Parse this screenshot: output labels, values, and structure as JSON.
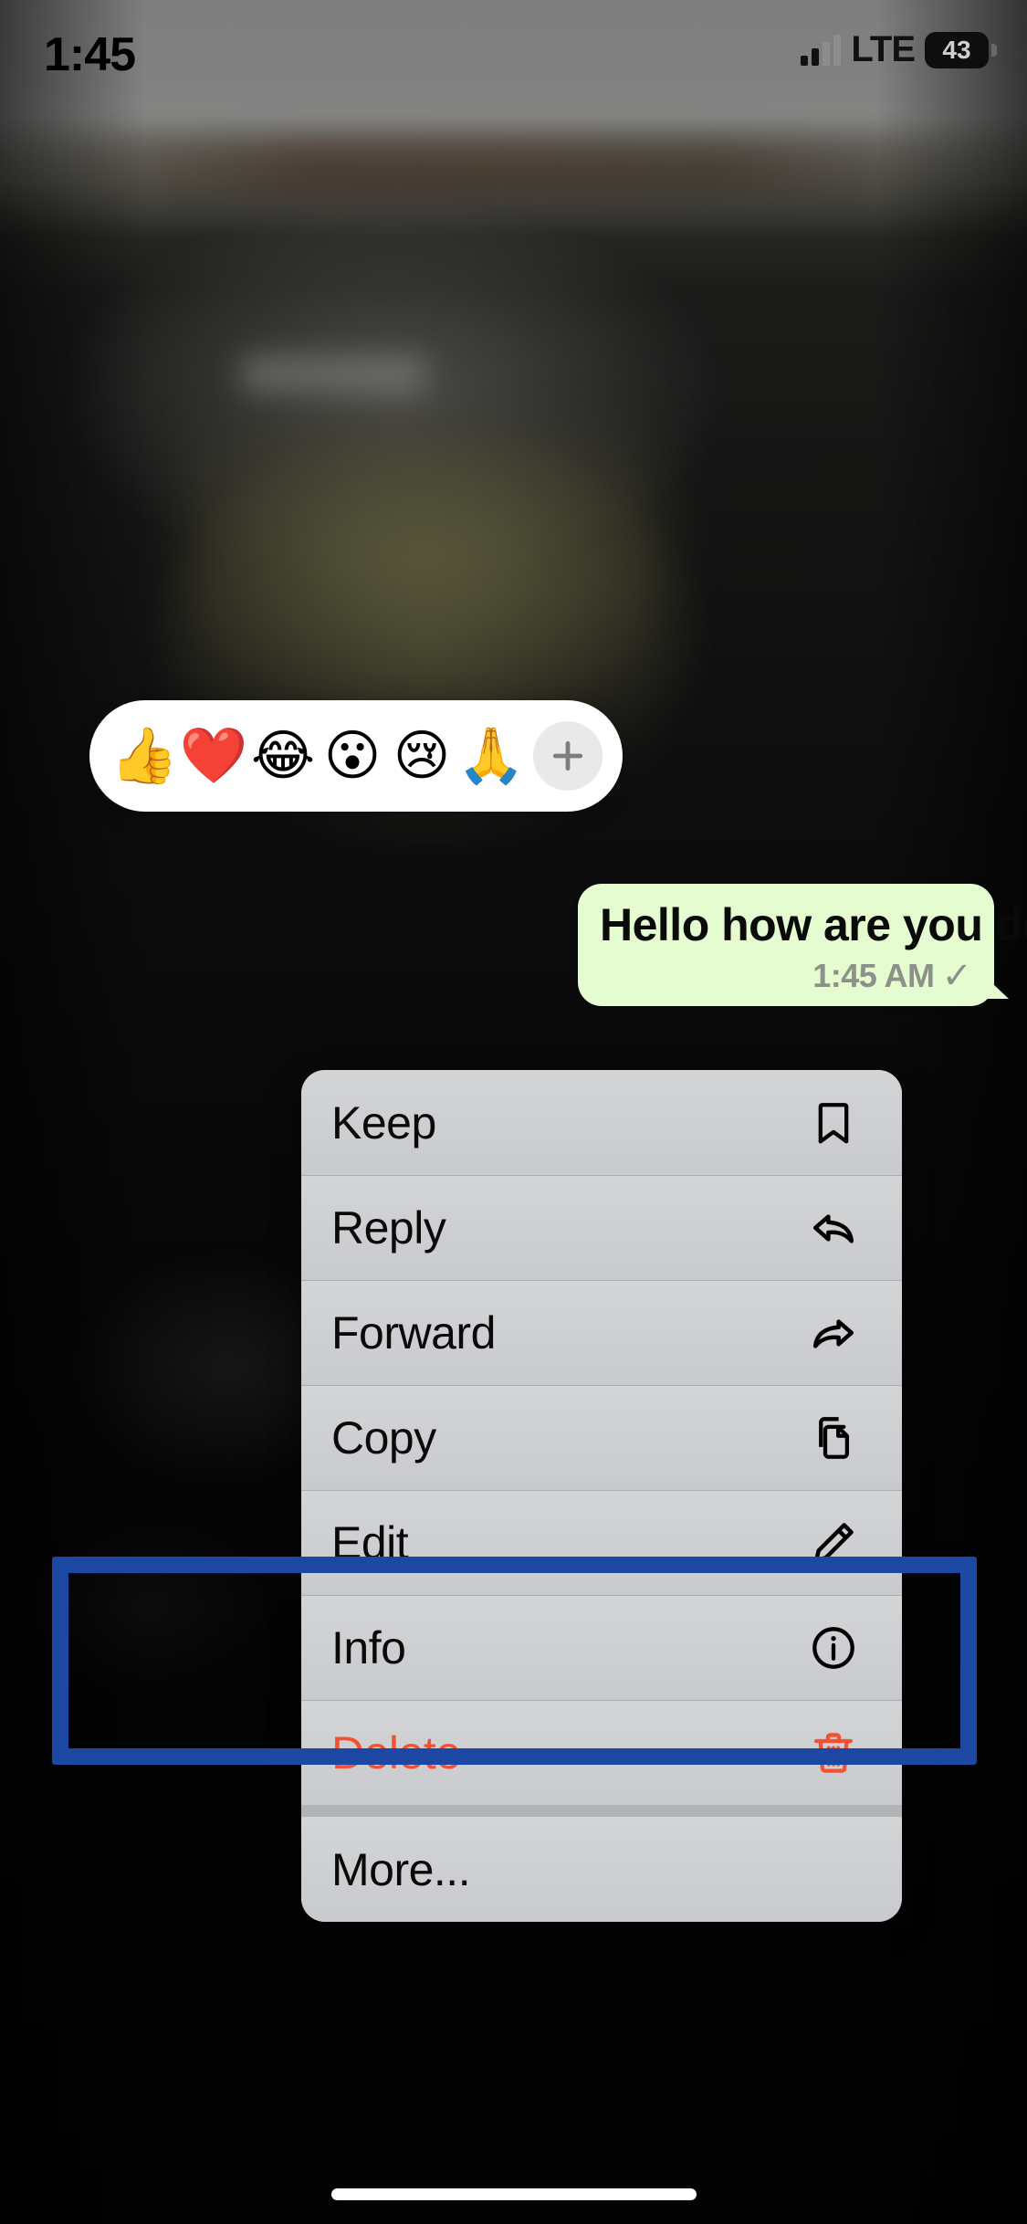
{
  "status_bar": {
    "time": "1:45",
    "network_label": "LTE",
    "battery_percent": "43",
    "signal_icon": "cellular-signal-icon",
    "battery_icon": "battery-icon"
  },
  "reaction_bar": {
    "reactions": [
      {
        "name": "thumbs-up-reaction",
        "glyph": "👍"
      },
      {
        "name": "heart-reaction",
        "glyph": "❤️"
      },
      {
        "name": "tears-of-joy-reaction",
        "glyph": "😂"
      },
      {
        "name": "open-mouth-reaction",
        "glyph": "😮"
      },
      {
        "name": "crying-face-reaction",
        "glyph": "😢"
      },
      {
        "name": "folded-hands-reaction",
        "glyph": "🙏"
      }
    ],
    "more_button": {
      "name": "add-reaction-button",
      "icon": "plus-icon"
    }
  },
  "message": {
    "text": "Hello how are you doing",
    "time": "1:45 AM",
    "status_icon": "single-check-icon",
    "status_glyph": "✓",
    "bubble_color": "#e5fbd0"
  },
  "context_menu": {
    "items": [
      {
        "label": "Keep",
        "icon": "bookmark-icon",
        "danger": false
      },
      {
        "label": "Reply",
        "icon": "reply-arrow-icon",
        "danger": false
      },
      {
        "label": "Forward",
        "icon": "forward-arrow-icon",
        "danger": false
      },
      {
        "label": "Copy",
        "icon": "copy-icon",
        "danger": false
      },
      {
        "label": "Edit",
        "icon": "pencil-icon",
        "danger": false
      },
      {
        "label": "Info",
        "icon": "info-circle-icon",
        "danger": false
      },
      {
        "label": "Delete",
        "icon": "trash-icon",
        "danger": true
      },
      {
        "label": "More...",
        "icon": "none",
        "danger": false
      }
    ]
  },
  "annotation": {
    "target_label": "Edit",
    "highlight_color": "#1c47a3"
  },
  "colors": {
    "menu_background": "#cdcfd1",
    "delete_red": "#f74f33",
    "highlight_blue": "#1c47a3",
    "bubble_green": "#e5fbd0"
  }
}
